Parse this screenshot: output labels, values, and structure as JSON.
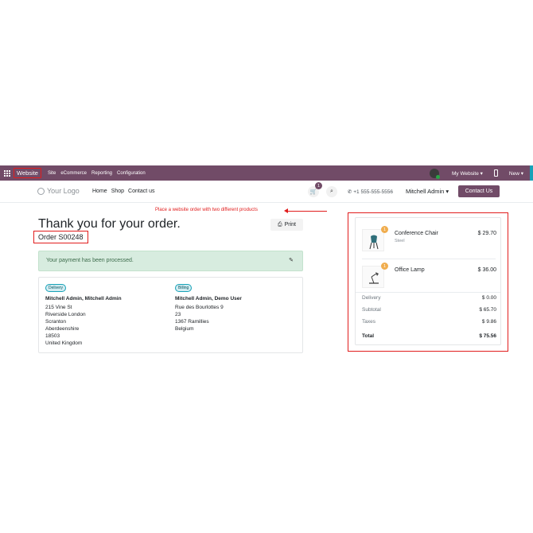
{
  "admin_bar": {
    "brand": "Website",
    "menus": [
      "Site",
      "eCommerce",
      "Reporting",
      "Configuration"
    ],
    "my_website": "My Website ▾",
    "new_label": "New ▾"
  },
  "header": {
    "logo": "Your Logo",
    "nav": [
      "Home",
      "Shop",
      "Contact us"
    ],
    "cart_count": "1",
    "phone": "+1 555-555-5556",
    "user": "Mitchell Admin ▾",
    "contact_button": "Contact Us"
  },
  "annotation": "Place a website order with two different products",
  "confirmation": {
    "title": "Thank you for your order.",
    "order_ref": "Order S00248",
    "print_label": "Print",
    "payment_message": "Your payment has been processed."
  },
  "addresses": {
    "delivery": {
      "badge": "Delivery",
      "name": "Mitchell Admin, Mitchell Admin",
      "lines": [
        "215 Vine St",
        "Riverside London",
        "Scranton",
        "Aberdeenshire",
        "18503",
        "United Kingdom"
      ]
    },
    "billing": {
      "badge": "Billing",
      "name": "Mitchell Admin, Demo User",
      "lines": [
        "Rue des Bourlottes 9",
        "23",
        "1367 Ramillies",
        "Belgium"
      ]
    }
  },
  "summary": {
    "items": [
      {
        "name": "Conference Chair",
        "desc": "Steel",
        "qty": "1",
        "price": "$ 29.70",
        "icon": "chair-image"
      },
      {
        "name": "Office Lamp",
        "desc": "",
        "qty": "1",
        "price": "$ 36.00",
        "icon": "lamp-image"
      }
    ],
    "totals": [
      {
        "label": "Delivery",
        "value": "$ 0.00"
      },
      {
        "label": "Subtotal",
        "value": "$ 65.70"
      },
      {
        "label": "Taxes",
        "value": "$ 9.86"
      }
    ],
    "total": {
      "label": "Total",
      "value": "$ 75.56"
    }
  }
}
